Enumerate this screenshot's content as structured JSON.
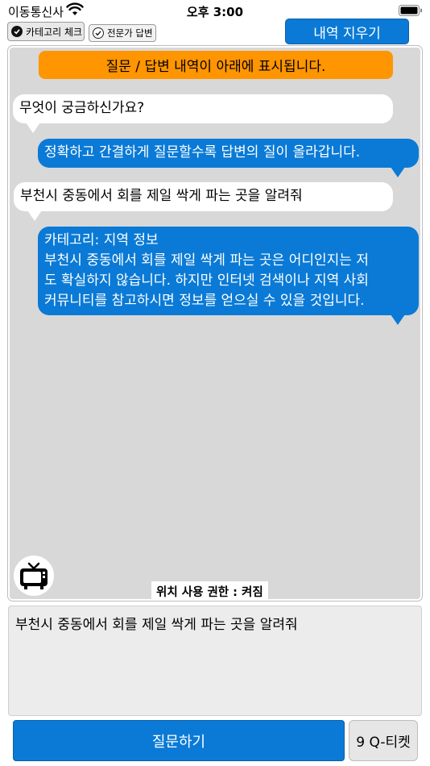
{
  "status_bar": {
    "carrier": "이동통신사",
    "time": "오후 3:00"
  },
  "toggles": {
    "category_check": "카테고리 체크",
    "expert_answer": "전문가 답변"
  },
  "header": {
    "clear_history_label": "내역 지우기"
  },
  "chat": {
    "banner": "질문 / 답변 내역이 아래에 표시됩니다.",
    "messages": [
      {
        "from": "app",
        "text": "무엇이 궁금하신가요?"
      },
      {
        "from": "assistant",
        "text": "정확하고 간결하게 질문할수록 답변의 질이 올라갑니다."
      },
      {
        "from": "user",
        "text": "부천시 중동에서 회를 제일 싹게 파는 곳을 알려줘"
      },
      {
        "from": "assistant",
        "lines": [
          "카테고리: 지역 정보",
          "부천시 중동에서 회를 제일 싹게 파는 곳은 어디인지는 저",
          "도 확실하지 않습니다. 하지만 인터넷 검색이나 지역 사회",
          "커뮤니티를 참고하시면 정보를 얻으실 수 있을 것입니다."
        ]
      }
    ],
    "location_status": "위치 사용 권한 : 켜짐"
  },
  "input": {
    "value": "부천시 중동에서 회를 제일 싹게 파는 곳을 알려줘"
  },
  "footer": {
    "ask_label": "질문하기",
    "ticket_label": "9 Q-티켓"
  },
  "icons": {
    "wifi": "wifi-icon",
    "battery": "battery-icon",
    "check": "checkmark-icon",
    "tv": "tv-icon"
  },
  "colors": {
    "accent_blue": "#0a7ad6",
    "banner_orange": "#ff9500",
    "chat_background": "#d8d8d8"
  }
}
